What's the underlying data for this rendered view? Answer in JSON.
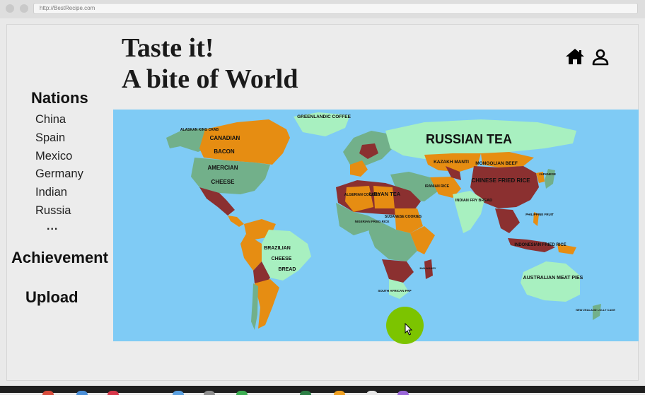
{
  "browser": {
    "url": "http://BestRecipe.com"
  },
  "header": {
    "title_line1": "Taste it!",
    "title_line2": "A bite of World"
  },
  "icons": {
    "home": "home-icon",
    "user": "user-icon"
  },
  "sidebar": {
    "heading": "Nations",
    "nations": [
      "China",
      "Spain",
      "Mexico",
      "Germany",
      "Indian",
      "Russia"
    ],
    "more": "...",
    "achievement": "Achievement",
    "upload": "Upload"
  },
  "map": {
    "labels": {
      "alaskan": "ALASKAN KING CRAB",
      "greenlandic": "GREENLANDIC COFFEE",
      "canadian": "CANADIAN",
      "bacon": "BACON",
      "american": "AMERCIAN",
      "cheese": "CHEESE",
      "russian_tea": "RUSSIAN TEA",
      "kazakh": "KAZAKH MANTI",
      "mongolian": "MONGOLIAN BEEF",
      "chinese": "CHINESE FRIED RICE",
      "japanese": "JAPANESE",
      "iranian": "IRANIAN RICE",
      "indian": "INDIAN FRY BREAD",
      "algerian": "ALGERIAN COOKIES",
      "libyan": "LIBYAN TEA",
      "sudanese": "SUDANESE COOKIES",
      "nigerian": "NIGERIAN FRIED RICE",
      "brazilian": "BRAZILIAN",
      "brazil_cheese": "CHEESE",
      "bread": "BREAD",
      "south_african": "SOUTH AFRICAN PAP",
      "indonesian": "INDONESIAN FRIED RICE",
      "australian": "AUSTRALIAN MEAT PIES",
      "nz": "NEW ZEALAND LOLLY CAKE",
      "philippine": "PHILIPPINE FRUIT",
      "malagasy": "MALAGASY"
    },
    "colors": {
      "ocean": "#7fcbf5",
      "green": "#72b08a",
      "mint": "#a8f0c0",
      "orange": "#e68d12",
      "maroon": "#8b3030"
    }
  },
  "taskbar_colors": [
    "#d84c3c",
    "#4a8fd8",
    "#d8384a",
    "#5aa0e0",
    "#8f8f8f",
    "#3cae52",
    "#2d7f45",
    "#f0a020",
    "#e8e8e8",
    "#9a66d8"
  ]
}
